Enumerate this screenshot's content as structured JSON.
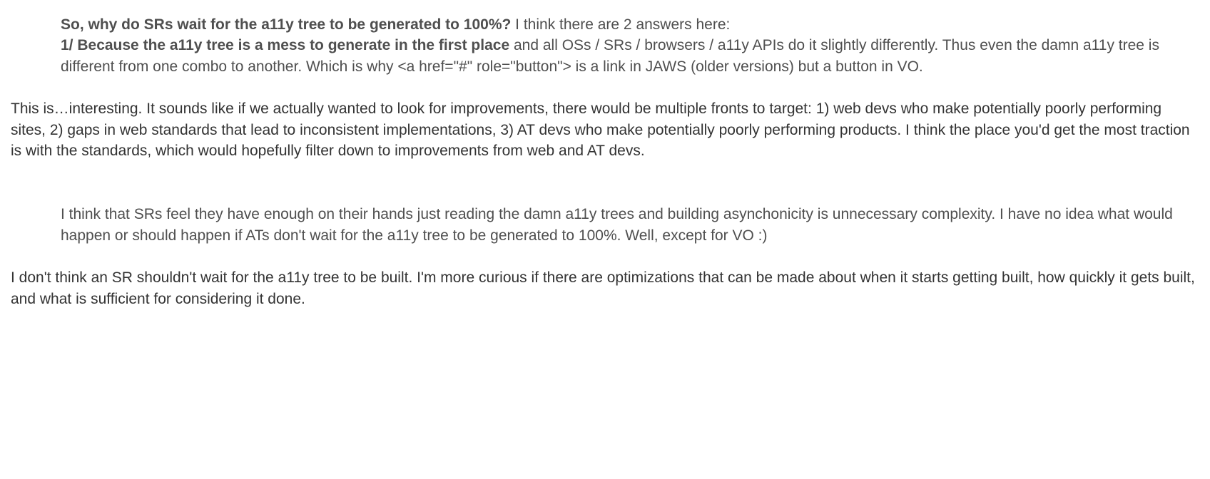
{
  "quote1": {
    "bold_q": "So, why do SRs wait for the a11y tree to be generated to 100%?",
    "after_q": " I think there are 2 answers here:",
    "bold_pt1": "1/ Because the a11y tree is a mess to generate in the first place",
    "pt1_rest": " and all OSs / SRs / browsers / a11y APIs do it slightly differently. Thus even the damn a11y tree is different from one combo to another. Which is why <a href=\"#\" role=\"button\"> is a link in JAWS (older versions) but a button in VO."
  },
  "reply1": "This is…interesting. It sounds like if we actually wanted to look for improvements, there would be multiple fronts to target: 1) web devs who make potentially poorly performing sites, 2) gaps in web standards that lead to inconsistent implementations, 3) AT devs who make potentially poorly performing products. I think the place you'd get the most traction is with the standards, which would hopefully filter down to improvements from web and AT devs.",
  "quote2": "I think that SRs feel they have enough on their hands just reading the damn a11y trees and building asynchonicity is unnecessary complexity. I have no idea what would happen or should happen if ATs don't wait for the a11y tree to be generated to 100%. Well, except for VO :)",
  "reply2": "I don't think an SR shouldn't wait for the a11y tree to be built. I'm more curious if there are optimizations that can be made about when it starts getting built, how quickly it gets built, and what is sufficient for considering it done."
}
